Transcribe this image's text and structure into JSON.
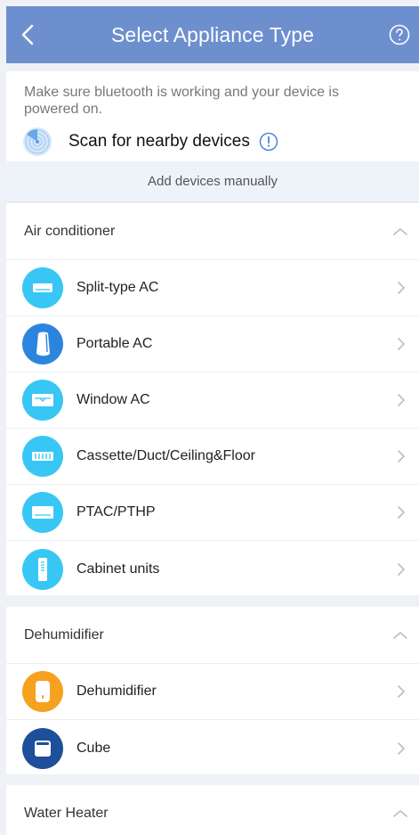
{
  "header": {
    "title": "Select Appliance Type"
  },
  "notice": {
    "text": "Make sure bluetooth is working and your device is powered on.",
    "scan_label": "Scan for nearby devices"
  },
  "manual": {
    "label": "Add devices manually"
  },
  "sections": [
    {
      "title": "Air conditioner",
      "items": [
        {
          "label": "Split-type AC",
          "icon": "split-ac-icon"
        },
        {
          "label": "Portable AC",
          "icon": "portable-ac-icon"
        },
        {
          "label": "Window AC",
          "icon": "window-ac-icon"
        },
        {
          "label": "Cassette/Duct/Ceiling&Floor",
          "icon": "cassette-icon"
        },
        {
          "label": "PTAC/PTHP",
          "icon": "ptac-icon"
        },
        {
          "label": "Cabinet units",
          "icon": "cabinet-icon"
        }
      ]
    },
    {
      "title": "Dehumidifier",
      "items": [
        {
          "label": "Dehumidifier",
          "icon": "dehumidifier-icon"
        },
        {
          "label": "Cube",
          "icon": "cube-icon"
        }
      ]
    },
    {
      "title": "Water Heater",
      "items": []
    }
  ],
  "colors": {
    "header": "#6d8fce",
    "ac_icon": "#38c7f4",
    "portable_icon": "#2b85dd",
    "dehumidifier_icon": "#f6a11f",
    "cube_icon": "#1d4f9a"
  }
}
